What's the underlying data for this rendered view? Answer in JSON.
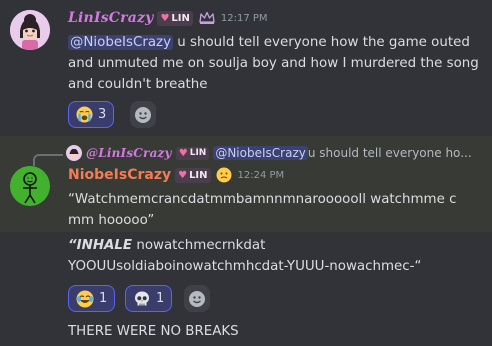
{
  "message1": {
    "author": "LinIsCrazy",
    "tag": "LIN",
    "timestamp": "12:17 PM",
    "mention": "@NiobeIsCrazy",
    "text_after_mention": " u should tell everyone how the game outed",
    "text_line2": "and unmuted me on soulja boy and how I murdered the song",
    "text_line3": "and couldn't breathe",
    "reactions": [
      {
        "emoji": "crying-face",
        "count": "3"
      }
    ]
  },
  "reply_preview": {
    "author": "@LinIsCrazy",
    "tag": "LIN",
    "mention": "@NiobeIsCrazy",
    "text": " u should tell everyone ho..."
  },
  "message2": {
    "author": "NiobeIsCrazy",
    "tag": "LIN",
    "timestamp": "12:24 PM",
    "text_line1": "“Watchmemcrancdatmmbamnnmnaroooooll watchmme c",
    "text_line2": "mm hooooo”",
    "inhale": "“INHALE",
    "text_line3_rest": " nowatchmecrnkdat",
    "text_line4": "YOOUUsoldiaboinowatchmhcdat-YUUU-nowachmec-“",
    "reactions": [
      {
        "emoji": "joy-face",
        "count": "1"
      },
      {
        "emoji": "skull",
        "count": "1"
      }
    ],
    "followup": "THERE WERE NO BREAKS"
  },
  "colors": {
    "background": "#323339",
    "lin_name": "#d27ae0",
    "niobe_name": "#f57b55",
    "mention_bg": "#3c4270"
  }
}
